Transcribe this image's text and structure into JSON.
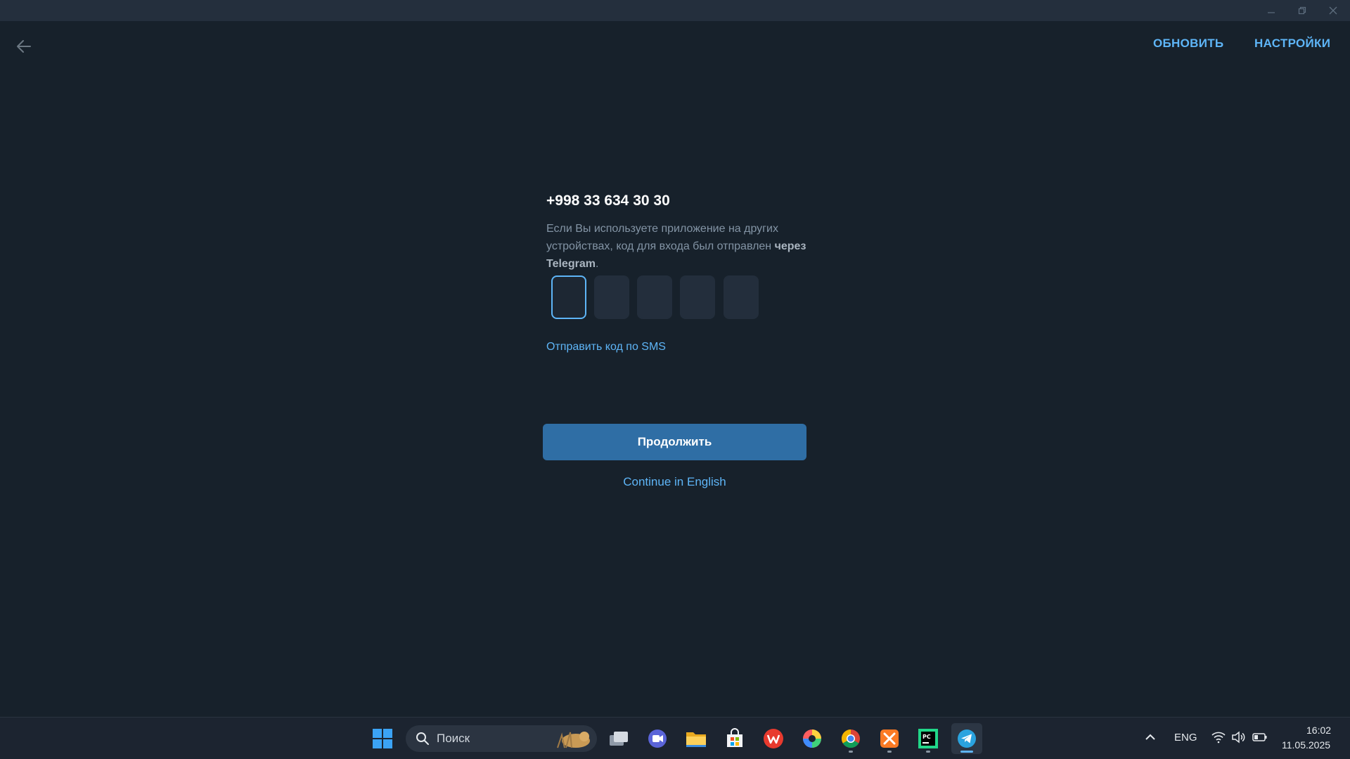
{
  "window": {
    "minimize_icon": "minimize-icon",
    "maximize_icon": "restore-icon",
    "close_icon": "close-icon"
  },
  "header": {
    "back_icon": "arrow-left-icon",
    "refresh_label": "ОБНОВИТЬ",
    "settings_label": "НАСТРОЙКИ"
  },
  "login": {
    "phone": "+998 33 634 30 30",
    "description_plain": "Если Вы используете приложение на других устройствах, код для входа был отправлен ",
    "description_bold": "через Telegram",
    "description_end": ".",
    "code_length": 5,
    "sms_link": "Отправить код по SMS",
    "continue_label": "Продолжить",
    "english_link": "Continue in English"
  },
  "taskbar": {
    "search_placeholder": "Поиск",
    "apps": [
      {
        "name": "windows-start-icon"
      },
      {
        "name": "task-view-icon"
      },
      {
        "name": "video-call-icon"
      },
      {
        "name": "file-explorer-icon"
      },
      {
        "name": "microsoft-store-icon"
      },
      {
        "name": "wps-office-icon"
      },
      {
        "name": "color-app-icon"
      },
      {
        "name": "chrome-icon"
      },
      {
        "name": "xampp-icon"
      },
      {
        "name": "pycharm-icon"
      },
      {
        "name": "telegram-icon"
      }
    ],
    "language": "ENG",
    "time": "16:02",
    "date": "11.05.2025"
  },
  "colors": {
    "background": "#17212b",
    "accent": "#5eb5f7",
    "button": "#2f6ea5",
    "muted_text": "#8394a5"
  }
}
